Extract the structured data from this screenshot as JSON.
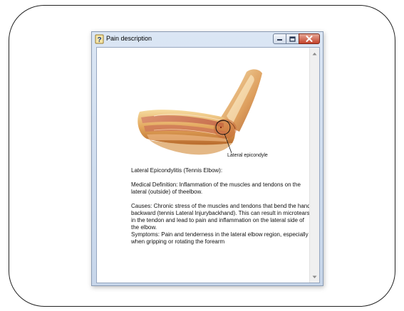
{
  "window": {
    "title": "Pain description",
    "icons": {
      "app": "help-question-icon",
      "minimize": "minimize-icon",
      "maximize": "maximize-icon",
      "close": "close-icon"
    },
    "close_color": "#c4422c"
  },
  "content": {
    "illustration": "elbow-muscle-illustration",
    "callout_label": "Lateral epicondyle",
    "heading": "Lateral Epicondylitis (Tennis Elbow):",
    "definition": "Medical Definition: Inflammation of the muscles and tendons on the lateral (outside) of theelbow.",
    "causes": "Causes: Chronic stress of the muscles and tendons that bend the hand backward (tennis Lateral Injurybackhand). This can result in microtears in the tendon and lead to pain and inflammation on the lateral side of the elbow.",
    "symptoms": "Symptoms: Pain and tenderness in the lateral elbow region, especially when gripping or rotating the forearm"
  },
  "scrollbar": {
    "up_icon": "scroll-up-arrow-icon",
    "down_icon": "scroll-down-arrow-icon"
  }
}
